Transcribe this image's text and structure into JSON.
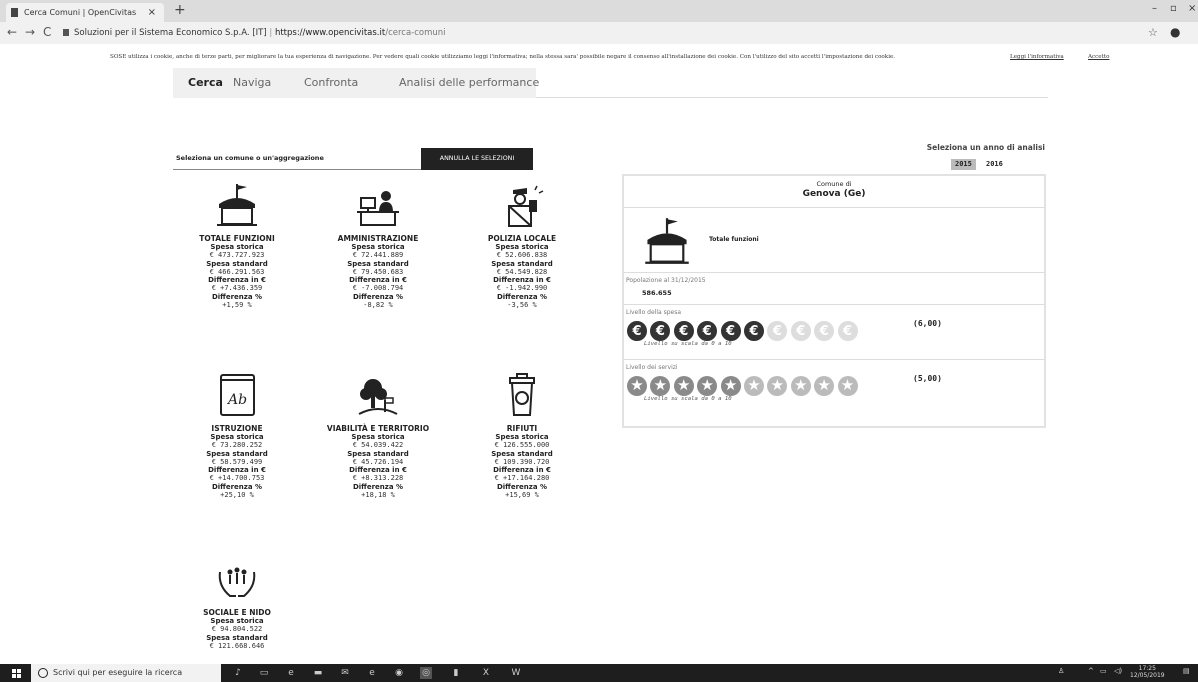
{
  "browser": {
    "tab_title": "Cerca Comuni | OpenCivitas",
    "tab_close": "×",
    "new_tab": "+",
    "back": "←",
    "forward": "→",
    "reload": "C",
    "site_identity": "Soluzioni per il Sistema Economico S.p.A. [IT]",
    "url_host": "https://www.opencivitas.it",
    "url_path": "/cerca-comuni",
    "minimize": "–",
    "restore": "▫",
    "close": "×"
  },
  "cookie": {
    "text": "SOSE utilizza i cookie, anche di terze parti, per migliorare la tua esperienza di navigazione. Per vedere quali cookie utilizziamo leggi l'informativa; nella stessa sara' possibile negare il consenso all'installazione dei cookie. Con l'utilizzo del sito accetti l'impostazione dei cookie.",
    "link": "Leggi l'informativa",
    "accept": "Accetto"
  },
  "nav": {
    "items": [
      "Cerca",
      "Naviga",
      "Confronta",
      "Analisi delle performance"
    ]
  },
  "search": {
    "placeholder": "Seleziona un comune o un'aggregazione",
    "reset_label": "ANNULLA LE SELEZIONI"
  },
  "labels": {
    "storica": "Spesa storica",
    "standard": "Spesa standard",
    "diff_eur": "Differenza in €",
    "diff_pct": "Differenza %"
  },
  "functions": [
    {
      "name": "TOTALE FUNZIONI",
      "icon": "building-flag-icon",
      "storica": "€ 473.727.923",
      "standard": "€ 466.291.563",
      "diff_eur": "€ +7.436.359",
      "diff_pct": "+1,59 %"
    },
    {
      "name": "AMMINISTRAZIONE",
      "icon": "office-desk-icon",
      "storica": "€ 72.441.889",
      "standard": "€ 79.450.683",
      "diff_eur": "€ -7.008.794",
      "diff_pct": "-8,82 %"
    },
    {
      "name": "POLIZIA LOCALE",
      "icon": "police-officer-icon",
      "storica": "€ 52.606.838",
      "standard": "€ 54.549.828",
      "diff_eur": "€ -1.942.990",
      "diff_pct": "-3,56 %"
    },
    {
      "name": "ISTRUZIONE",
      "icon": "book-icon",
      "storica": "€ 73.280.252",
      "standard": "€ 58.579.499",
      "diff_eur": "€ +14.700.753",
      "diff_pct": "+25,10 %"
    },
    {
      "name": "VIABILITÀ E TERRITORIO",
      "icon": "tree-road-icon",
      "storica": "€ 54.039.422",
      "standard": "€ 45.726.194",
      "diff_eur": "€ +8.313.228",
      "diff_pct": "+18,18 %"
    },
    {
      "name": "RIFIUTI",
      "icon": "trash-bin-icon",
      "storica": "€ 126.555.000",
      "standard": "€ 109.390.720",
      "diff_eur": "€ +17.164.280",
      "diff_pct": "+15,69 %"
    },
    {
      "name": "SOCIALE E NIDO",
      "icon": "hands-family-icon",
      "storica": "€ 94.804.522",
      "standard": "€ 121.668.646",
      "diff_eur": "",
      "diff_pct": ""
    }
  ],
  "panel": {
    "year_title": "Seleziona un anno di analisi",
    "years": [
      "2015",
      "2016"
    ],
    "selected_year": "2015",
    "comune_label": "Comune di",
    "comune_name": "Genova (Ge)",
    "totale_label": "Totale funzioni",
    "pop_label": "Popolazione al 31/12/2015",
    "pop_value": "586.655",
    "spesa_label": "Livello della spesa",
    "spesa_score": "(6,00)",
    "spesa_level": 6,
    "servizi_label": "Livello dei servizi",
    "servizi_score": "(5,00)",
    "servizi_level": 5,
    "scale_note": "Livello su scala da 0 a 10",
    "coin_glyph": "€",
    "star_glyph": "★"
  },
  "taskbar": {
    "search_placeholder": "Scrivi qui per eseguire la ricerca",
    "time": "17:25",
    "date": "12/05/2019"
  }
}
